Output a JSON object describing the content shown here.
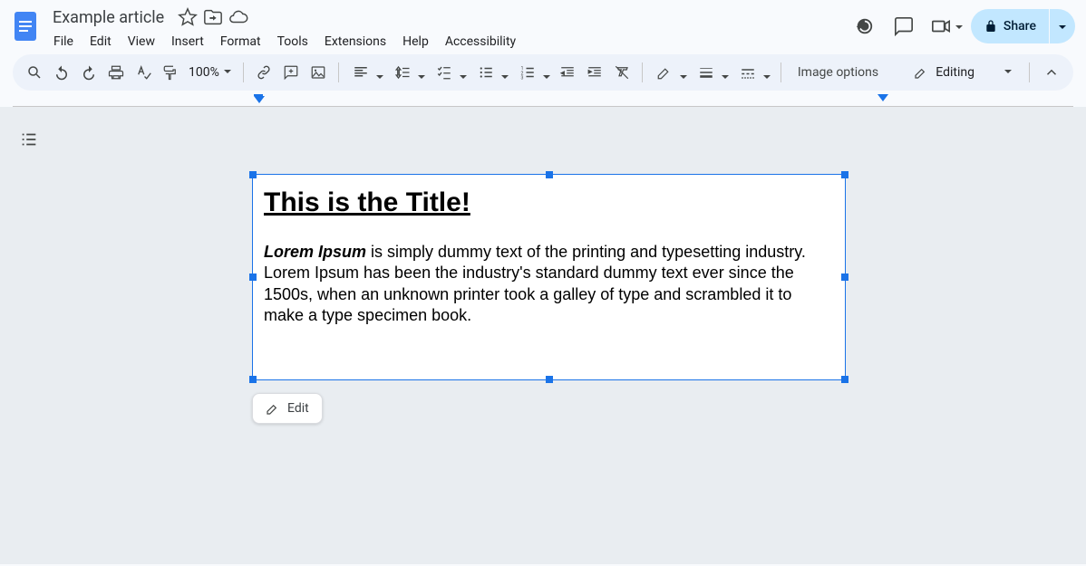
{
  "header": {
    "doc_title": "Example article",
    "menus": [
      "File",
      "Edit",
      "View",
      "Insert",
      "Format",
      "Tools",
      "Extensions",
      "Help",
      "Accessibility"
    ],
    "share_label": "Share"
  },
  "toolbar": {
    "zoom": "100%",
    "image_options": "Image options",
    "editing_mode": "Editing"
  },
  "content": {
    "title": "This is the Title!",
    "lead": "Lorem Ipsum",
    "body_after_lead": " is simply dummy text of the printing and typesetting industry. Lorem Ipsum has been the industry's standard dummy text ever since the 1500s, when an unknown printer took a galley of type and scrambled it to make a type specimen book."
  },
  "popover": {
    "edit": "Edit"
  }
}
